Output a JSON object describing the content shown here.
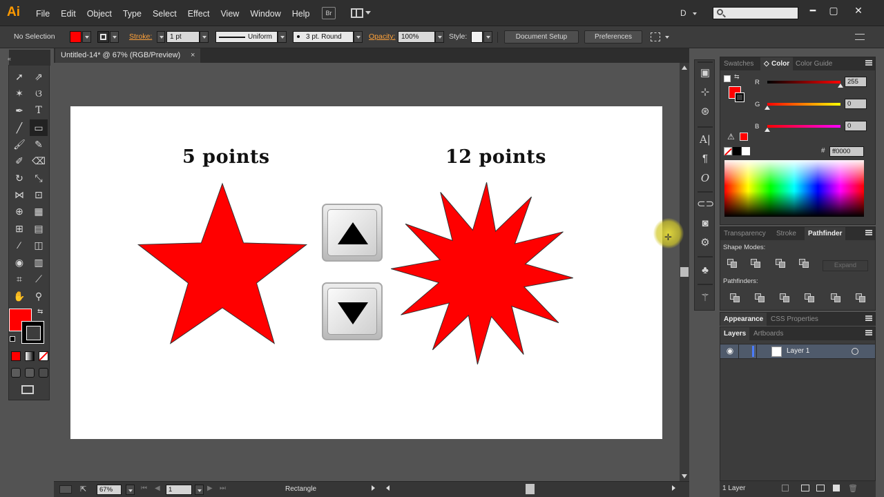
{
  "app": {
    "logo": "Ai"
  },
  "menu": [
    "File",
    "Edit",
    "Object",
    "Type",
    "Select",
    "Effect",
    "View",
    "Window",
    "Help"
  ],
  "menubar": {
    "bridge_label": "Br",
    "workspace": "D",
    "search_placeholder": "",
    "minimize": "━",
    "restore": "▢",
    "close": "✕"
  },
  "control": {
    "selection": "No Selection",
    "fill_color": "#ff0000",
    "stroke_label": "Stroke:",
    "stroke_weight": "1 pt",
    "profile": "Uniform",
    "brush": "3 pt. Round",
    "opacity_label": "Opacity:",
    "opacity_value": "100%",
    "style_label": "Style:",
    "document_setup": "Document Setup",
    "preferences": "Preferences"
  },
  "document": {
    "tab_title": "Untitled-14* @ 67% (RGB/Preview)",
    "tab_close": "×",
    "labels": [
      "5 points",
      "12 points"
    ],
    "star_color": "#ff0000"
  },
  "status": {
    "zoom": "67%",
    "artboard": "1",
    "tool": "Rectangle"
  },
  "color_panel": {
    "tabs": [
      "Swatches",
      "Color",
      "Color Guide"
    ],
    "active_tab": "Color",
    "channels": [
      {
        "label": "R",
        "value": "255"
      },
      {
        "label": "G",
        "value": "0"
      },
      {
        "label": "B",
        "value": "0"
      }
    ],
    "hex_label": "#",
    "hex_value": "ff0000"
  },
  "pathfinder_panel": {
    "tabs": [
      "Transparency",
      "Stroke",
      "Pathfinder"
    ],
    "active_tab": "Pathfinder",
    "shape_modes": "Shape Modes:",
    "pathfinders": "Pathfinders:",
    "expand": "Expand"
  },
  "appearance_panel": {
    "tabs": [
      "Appearance",
      "CSS Properties"
    ]
  },
  "layers_panel": {
    "tabs": [
      "Layers",
      "Artboards"
    ],
    "layers": [
      {
        "name": "Layer 1"
      }
    ],
    "footer": "1 Layer"
  }
}
